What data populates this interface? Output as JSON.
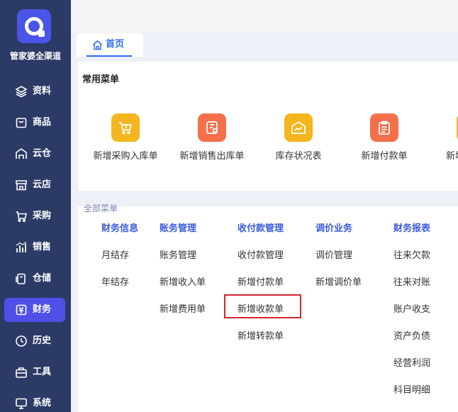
{
  "app": {
    "brand": "管家婆全渠道"
  },
  "sidebar": {
    "items": [
      {
        "label": "资料",
        "icon": "layers-icon",
        "active": false
      },
      {
        "label": "商品",
        "icon": "box-icon",
        "active": false
      },
      {
        "label": "云仓",
        "icon": "warehouse-cloud-icon",
        "active": false
      },
      {
        "label": "云店",
        "icon": "store-icon",
        "active": false
      },
      {
        "label": "采购",
        "icon": "cart-icon",
        "active": false
      },
      {
        "label": "销售",
        "icon": "chart-icon",
        "active": false
      },
      {
        "label": "仓储",
        "icon": "storage-icon",
        "active": false
      },
      {
        "label": "财务",
        "icon": "finance-icon",
        "active": true
      },
      {
        "label": "历史",
        "icon": "clock-icon",
        "active": false
      },
      {
        "label": "工具",
        "icon": "toolbox-icon",
        "active": false
      },
      {
        "label": "系统",
        "icon": "monitor-icon",
        "active": false
      }
    ]
  },
  "tabs": [
    {
      "label": "首页",
      "icon": "home-icon",
      "active": true
    }
  ],
  "quick_menu": {
    "title": "常用菜单",
    "items": [
      {
        "label": "新增采购入库单",
        "icon": "purchase-cart-icon",
        "color": "#f5b51f"
      },
      {
        "label": "新增销售出库单",
        "icon": "sales-doc-icon",
        "color": "#f4704b"
      },
      {
        "label": "库存状况表",
        "icon": "inventory-chart-icon",
        "color": "#f5b51f"
      },
      {
        "label": "新增付款单",
        "icon": "payment-doc-icon",
        "color": "#f4704b"
      },
      {
        "label": "新增",
        "icon": "partial-icon",
        "color": "#f5b51f"
      }
    ]
  },
  "menu_panel": {
    "header_peek": "全部菜单",
    "columns": [
      {
        "title": "财务信息",
        "items": [
          "月结存",
          "年结存"
        ]
      },
      {
        "title": "账务管理",
        "items": [
          "账务管理",
          "新增收入单",
          "新增费用单"
        ]
      },
      {
        "title": "收付款管理",
        "items": [
          "收付款管理",
          "新增付款单",
          "新增收款单",
          "新增转款单"
        ]
      },
      {
        "title": "调价业务",
        "items": [
          "调价管理",
          "新增调价单"
        ]
      },
      {
        "title": "财务报表",
        "items": [
          "往来欠款",
          "往来对账",
          "账户收支",
          "资产负债",
          "经营利润",
          "科目明细"
        ]
      }
    ],
    "highlighted": "新增收款单"
  },
  "colors": {
    "sidebar": "#2c3a66",
    "active": "#5050e8",
    "accent": "#2d6df6",
    "highlight_border": "#d6262d",
    "column_head": "#3b5bdb"
  }
}
